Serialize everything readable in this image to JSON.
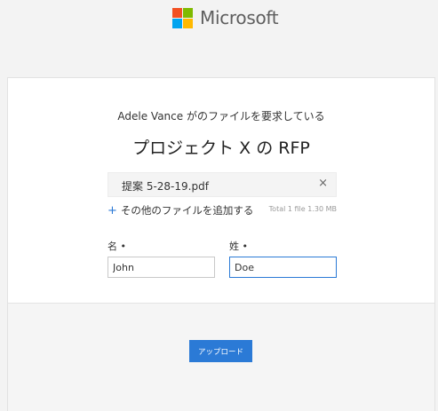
{
  "brand": {
    "name": "Microsoft",
    "colors": {
      "red": "#f25022",
      "green": "#7fba00",
      "blue": "#00a4ef",
      "yellow": "#ffb900"
    }
  },
  "request": {
    "text": "Adele Vance がのファイルを要求している",
    "title": "プロジェクト X の RFP"
  },
  "file": {
    "name": "提案 5-28-19.pdf",
    "remove_icon": "×"
  },
  "add_files": {
    "plus": "+",
    "label": "その他のファイルを追加する",
    "total": "Total 1 file  1.30 MB"
  },
  "form": {
    "first_name_label": "名 •",
    "first_name_value": "John",
    "last_name_label": "姓 •",
    "last_name_value": "Doe"
  },
  "upload_button": "アップロード",
  "accent_color": "#2b7ad6"
}
